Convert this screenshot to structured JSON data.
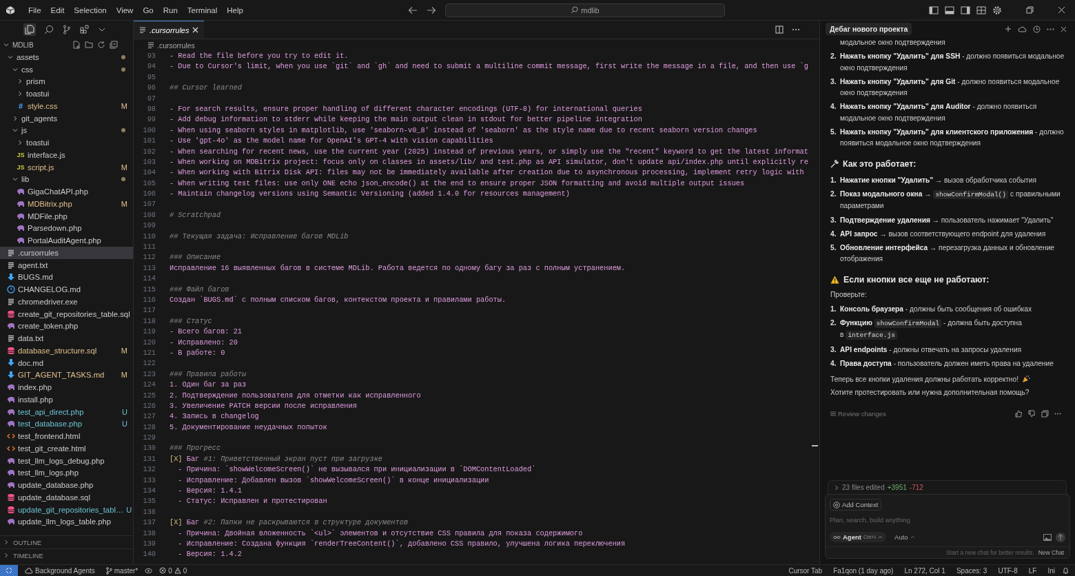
{
  "title_bar": {
    "menu": [
      "File",
      "Edit",
      "Selection",
      "View",
      "Go",
      "Run",
      "Terminal",
      "Help"
    ],
    "search": {
      "value": "mdlib"
    }
  },
  "explorer": {
    "title": "MDLIB",
    "tree": [
      {
        "kind": "folder",
        "name": "assets",
        "expanded": true,
        "changes": true,
        "selected": false,
        "children": [
          {
            "kind": "folder",
            "name": "css",
            "expanded": true,
            "changes": true,
            "selected": false,
            "children": [
              {
                "kind": "folder",
                "name": "prism",
                "expanded": false,
                "selected": false
              },
              {
                "kind": "folder",
                "name": "toastui",
                "expanded": false,
                "selected": false
              },
              {
                "kind": "stylesheet",
                "glyph": "#",
                "name": "style.css",
                "status": "M",
                "selected": false
              }
            ]
          },
          {
            "kind": "folder",
            "name": "git_agents",
            "expanded": false,
            "selected": false
          },
          {
            "kind": "folder",
            "name": "js",
            "expanded": true,
            "changes": true,
            "selected": false,
            "children": [
              {
                "kind": "folder",
                "name": "toastui",
                "expanded": false,
                "selected": false
              },
              {
                "kind": "script",
                "glyph": "JS",
                "name": "interface.js",
                "selected": false
              },
              {
                "kind": "script",
                "glyph": "JS",
                "name": "script.js",
                "status": "M",
                "selected": false
              }
            ]
          },
          {
            "kind": "folder",
            "name": "lib",
            "expanded": true,
            "changes": true,
            "selected": false,
            "children": [
              {
                "kind": "php",
                "name": "GigaChatAPI.php",
                "selected": false
              },
              {
                "kind": "php",
                "name": "MDBitrix.php",
                "status": "M",
                "selected": false
              },
              {
                "kind": "php",
                "name": "MDFile.php",
                "selected": false
              },
              {
                "kind": "php",
                "name": "Parsedown.php",
                "selected": false
              },
              {
                "kind": "php",
                "name": "PortalAuditAgent.php",
                "selected": false
              }
            ]
          }
        ]
      },
      {
        "kind": "plain",
        "name": ".cursorrules",
        "selected": true
      },
      {
        "kind": "plain",
        "name": "agent.txt",
        "selected": false
      },
      {
        "kind": "markdown",
        "name": "BUGS.md",
        "selected": false
      },
      {
        "kind": "changelog",
        "name": "CHANGELOG.md",
        "selected": false
      },
      {
        "kind": "plain",
        "name": "chromedriver.exe",
        "selected": false
      },
      {
        "kind": "sql",
        "name": "create_git_repositories_table.sql",
        "selected": false
      },
      {
        "kind": "php",
        "name": "create_token.php",
        "selected": false
      },
      {
        "kind": "plain",
        "name": "data.txt",
        "selected": false
      },
      {
        "kind": "sql",
        "name": "database_structure.sql",
        "status": "M",
        "selected": false
      },
      {
        "kind": "markdown",
        "name": "doc.md",
        "selected": false
      },
      {
        "kind": "markdown",
        "name": "GIT_AGENT_TASKS.md",
        "status": "M",
        "selected": false
      },
      {
        "kind": "php",
        "name": "index.php",
        "selected": false
      },
      {
        "kind": "php",
        "name": "install.php",
        "selected": false
      },
      {
        "kind": "php",
        "name": "test_api_direct.php",
        "status": "U",
        "selected": false
      },
      {
        "kind": "php",
        "name": "test_database.php",
        "status": "U",
        "selected": false
      },
      {
        "kind": "html",
        "name": "test_frontend.html",
        "selected": false
      },
      {
        "kind": "html",
        "name": "test_git_create.html",
        "selected": false
      },
      {
        "kind": "php",
        "name": "test_llm_logs_debug.php",
        "selected": false
      },
      {
        "kind": "php",
        "name": "test_llm_logs.php",
        "selected": false
      },
      {
        "kind": "php",
        "name": "update_database.php",
        "selected": false
      },
      {
        "kind": "sql",
        "name": "update_database.sql",
        "selected": false
      },
      {
        "kind": "sql",
        "name": "update_git_repositories_tabl…",
        "status": "U",
        "selected": false
      },
      {
        "kind": "php",
        "name": "update_llm_logs_table.php",
        "selected": false
      }
    ],
    "sections": [
      {
        "name": "OUTLINE",
        "expanded": false
      },
      {
        "name": "TIMELINE",
        "expanded": false
      }
    ]
  },
  "editor": {
    "tab": ".cursorrules",
    "breadcrumb": ".cursorrules",
    "lines": [
      {
        "n": "93",
        "kind": "text",
        "text": "- Read the file before you try to edit it."
      },
      {
        "n": "94",
        "kind": "text",
        "text": "- Due to Cursor's limit, when you use `git` and `gh` and need to submit a multiline commit message, first write the message in a file, and then use `g"
      },
      {
        "n": "95",
        "kind": "blank"
      },
      {
        "n": "96",
        "kind": "heading",
        "text": "## Cursor learned"
      },
      {
        "n": "97",
        "kind": "blank"
      },
      {
        "n": "98",
        "kind": "text",
        "text": "- For search results, ensure proper handling of different character encodings (UTF-8) for international queries"
      },
      {
        "n": "99",
        "kind": "text",
        "text": "- Add debug information to stderr while keeping the main output clean in stdout for better pipeline integration"
      },
      {
        "n": "100",
        "kind": "text",
        "text": "- When using seaborn styles in matplotlib, use 'seaborn-v0_8' instead of 'seaborn' as the style name due to recent seaborn version changes"
      },
      {
        "n": "101",
        "kind": "text",
        "text": "- Use 'gpt-4o' as the model name for OpenAI's GPT-4 with vision capabilities"
      },
      {
        "n": "102",
        "kind": "text",
        "text": "- When searching for recent news, use the current year (2025) instead of previous years, or simply use the \"recent\" keyword to get the latest informat"
      },
      {
        "n": "103",
        "kind": "text",
        "text": "- When working on MDBitrix project: focus only on classes in assets/lib/ and test.php as API simulator, don't update api/index.php until explicitly re"
      },
      {
        "n": "104",
        "kind": "text",
        "text": "- When working with Bitrix Disk API: files may not be immediately available after creation due to asynchronous processing, implement retry logic with"
      },
      {
        "n": "105",
        "kind": "text",
        "text": "- When writing test files: use only ONE echo json_encode() at the end to ensure proper JSON formatting and avoid multiple output issues"
      },
      {
        "n": "106",
        "kind": "text",
        "text": "- Maintain changelog versions using Semantic Versioning (added 1.4.0 for resources management)"
      },
      {
        "n": "107",
        "kind": "blank"
      },
      {
        "n": "108",
        "kind": "heading",
        "text": "# Scratchpad"
      },
      {
        "n": "109",
        "kind": "blank"
      },
      {
        "n": "110",
        "kind": "heading",
        "text": "## Текущая задача: Исправление багов MDLib"
      },
      {
        "n": "111",
        "kind": "blank"
      },
      {
        "n": "112",
        "kind": "heading",
        "text": "### Описание"
      },
      {
        "n": "113",
        "kind": "text",
        "text": "Исправление 16 выявленных багов в системе MDLib. Работа ведется по одному багу за раз с полным устранением."
      },
      {
        "n": "114",
        "kind": "blank"
      },
      {
        "n": "115",
        "kind": "heading",
        "text": "### Файл багов"
      },
      {
        "n": "116",
        "kind": "text",
        "text": "Создан `BUGS.md` с полным списком багов, контекстом проекта и правилами работы."
      },
      {
        "n": "117",
        "kind": "blank"
      },
      {
        "n": "118",
        "kind": "heading",
        "text": "### Статус"
      },
      {
        "n": "119",
        "kind": "text",
        "text": "- Всего багов: 21"
      },
      {
        "n": "120",
        "kind": "text",
        "text": "- Исправлено: 20"
      },
      {
        "n": "121",
        "kind": "text",
        "text": "- В работе: 0"
      },
      {
        "n": "122",
        "kind": "blank"
      },
      {
        "n": "123",
        "kind": "heading",
        "text": "### Правила работы"
      },
      {
        "n": "124",
        "kind": "text",
        "text": "1. Один баг за раз"
      },
      {
        "n": "125",
        "kind": "text",
        "text": "2. Подтверждение пользователя для отметки как исправленного"
      },
      {
        "n": "126",
        "kind": "text",
        "text": "3. Увеличение PATCH версии после исправления"
      },
      {
        "n": "127",
        "kind": "text",
        "text": "4. Запись в changelog"
      },
      {
        "n": "128",
        "kind": "text",
        "text": "5. Документирование неудачных попыток"
      },
      {
        "n": "129",
        "kind": "blank"
      },
      {
        "n": "130",
        "kind": "heading",
        "text": "### Прогресс"
      },
      {
        "n": "131",
        "kind": "task",
        "check": "[X]",
        "checked": true,
        "text": "Баг",
        "note": "#1: Приветственный экран пуст при загрузке"
      },
      {
        "n": "132",
        "kind": "text",
        "text": "  - Причина: `showWelcomeScreen()` не вызывался при инициализации в `DOMContentLoaded`"
      },
      {
        "n": "133",
        "kind": "text",
        "text": "  - Исправление: Добавлен вызов `showWelcomeScreen()` в конце инициализации"
      },
      {
        "n": "134",
        "kind": "text",
        "text": "  - Версия: 1.4.1"
      },
      {
        "n": "135",
        "kind": "text",
        "text": "  - Статус: Исправлен и протестирован"
      },
      {
        "n": "136",
        "kind": "blank"
      },
      {
        "n": "137",
        "kind": "task",
        "check": "[X]",
        "checked": true,
        "text": "Баг",
        "note": "#2: Папки не раскрываются в структуре документов"
      },
      {
        "n": "138",
        "kind": "text",
        "text": "  - Причина: Двойная вложенность `<ul>` элементов и отсутствие CSS правила для показа содержимого"
      },
      {
        "n": "139",
        "kind": "text",
        "text": "  - Исправление: Создана функция `renderTreeContent()`, добавлено CSS правило, улучшена логика переключения"
      },
      {
        "n": "140",
        "kind": "text",
        "text": "  - Версия: 1.4.2"
      }
    ]
  },
  "chat": {
    "title": "Дебаг нового проекта",
    "blocks": [
      {
        "kind": "list",
        "items": [
          {
            "parts": [
              {
                "kind": "text",
                "text": "модальное окно подтверждения"
              }
            ]
          },
          {
            "num": "2.",
            "parts": [
              {
                "kind": "text",
                "text": "**Нажать кнопку \"Удалить\" для SSH** - должно появиться модальное окно подтверждения"
              }
            ]
          },
          {
            "num": "3.",
            "parts": [
              {
                "kind": "text",
                "text": "**Нажать кнопку \"Удалить\" для Git** - должно появиться модальное окно подтверждения"
              }
            ]
          },
          {
            "num": "4.",
            "parts": [
              {
                "kind": "text",
                "text": "**Нажать кнопку \"Удалить\" для Auditor** - должно появиться модальное окно подтверждения"
              }
            ]
          },
          {
            "num": "5.",
            "parts": [
              {
                "kind": "text",
                "text": "**Нажать кнопку \"Удалить\" для клиентского приложения** - должно появиться модальное окно подтверждения"
              }
            ]
          }
        ]
      },
      {
        "kind": "heading-tip",
        "text": "Как это работает:"
      },
      {
        "kind": "list",
        "items": [
          {
            "num": "1.",
            "parts": [
              {
                "kind": "text",
                "text": "**Нажатие кнопки \"Удалить\"** → вызов обработчика события"
              }
            ]
          },
          {
            "num": "2.",
            "parts": [
              {
                "kind": "text",
                "text": "**Показ модального окна** →"
              },
              {
                "kind": "code",
                "text": "showConfirmModal()"
              },
              {
                "kind": "text",
                "text": "с правильными параметрами"
              }
            ]
          },
          {
            "num": "3.",
            "parts": [
              {
                "kind": "text",
                "text": "**Подтверждение удаления** → пользователь нажимает \"Удалить\""
              }
            ]
          },
          {
            "num": "4.",
            "parts": [
              {
                "kind": "text",
                "text": "**API запрос** → вызов соответствующего endpoint для удаления"
              }
            ]
          },
          {
            "num": "5.",
            "parts": [
              {
                "kind": "text",
                "text": "**Обновление интерфейса** → перезагрузка данных и обновление отображения"
              }
            ]
          }
        ]
      },
      {
        "kind": "heading-warning",
        "text": "Если кнопки все еще не работают:"
      },
      {
        "kind": "para",
        "text": "Проверьте:"
      },
      {
        "kind": "list",
        "items": [
          {
            "num": "1.",
            "parts": [
              {
                "kind": "text",
                "text": "**Консоль браузера** - должны быть сообщения об ошибках"
              }
            ]
          },
          {
            "num": "2.",
            "parts": [
              {
                "kind": "text",
                "text": "**Функцию**"
              },
              {
                "kind": "code",
                "text": "showConfirmModal"
              },
              {
                "kind": "text",
                "text": "- должна быть доступна в"
              },
              {
                "kind": "code",
                "text": "interface.js"
              }
            ]
          },
          {
            "num": "3.",
            "parts": [
              {
                "kind": "text",
                "text": "**API endpoints** - должны отвечать на запросы удаления"
              }
            ]
          },
          {
            "num": "4.",
            "parts": [
              {
                "kind": "text",
                "text": "**Права доступа** - пользователь должен иметь права на удаление"
              }
            ]
          }
        ]
      },
      {
        "kind": "para",
        "text": "Теперь все кнопки удаления должны работать корректно!",
        "celebration": true
      },
      {
        "kind": "para",
        "text": "Хотите протестировать или нужна дополнительная помощь?"
      }
    ],
    "review": "Review changes",
    "files_edited": {
      "summary": "23 files edited",
      "added": "+3951",
      "removed": "-712"
    },
    "composer": {
      "context_button": "Add Context",
      "placeholder": "Plan, search, build anything",
      "mode": "Agent",
      "shortcut": "Ctrl+I",
      "model": "Auto",
      "hint": "Start a new chat for better results.",
      "new_chat": "New Chat"
    }
  },
  "status_bar": {
    "left": {
      "agents": "Background Agents",
      "branch": "master*",
      "errors": "0",
      "warnings": "0"
    },
    "right": [
      "Cursor Tab",
      "Fa1qon (1 day ago)",
      "Ln 272, Col 1",
      "Spaces: 3",
      "UTF-8",
      "LF",
      "Ini"
    ]
  }
}
